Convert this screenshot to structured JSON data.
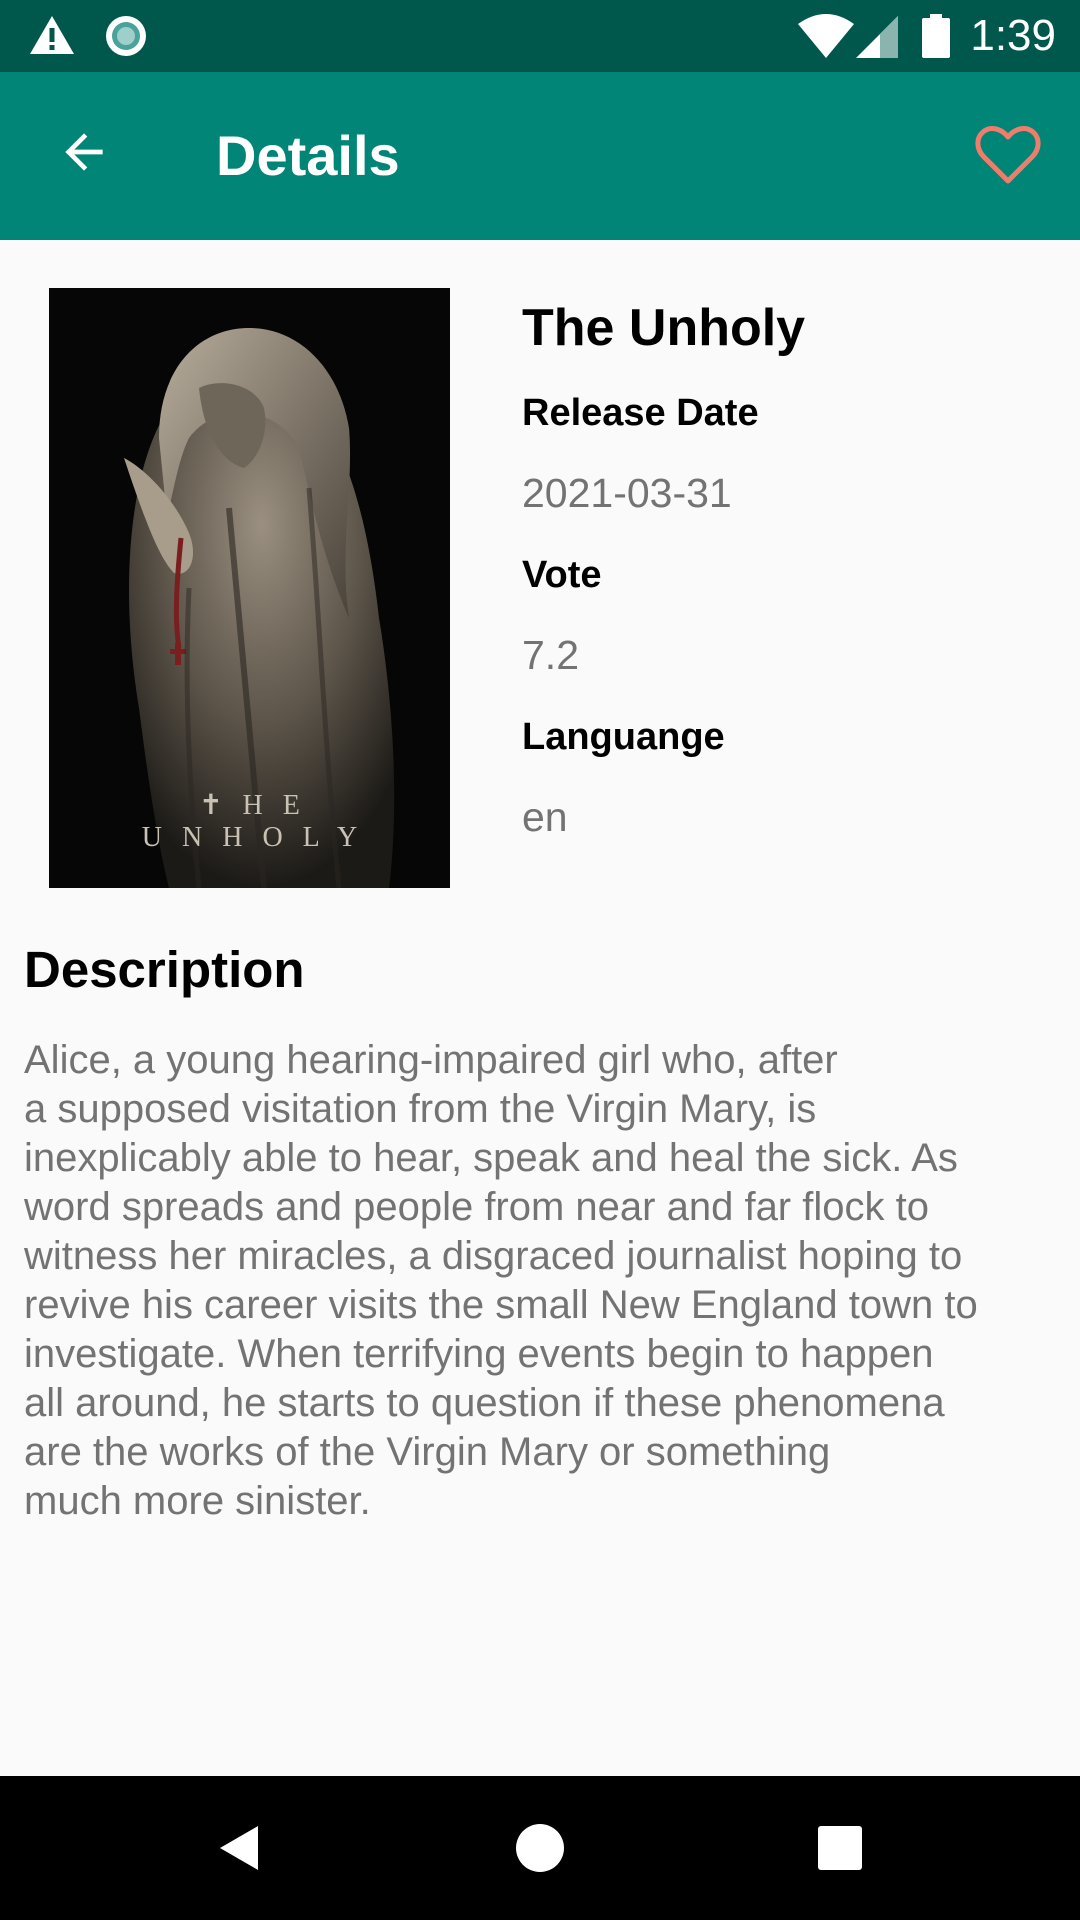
{
  "status_bar": {
    "time": "1:39",
    "icons": [
      "warning-icon",
      "sync-icon",
      "wifi-icon",
      "cell-signal-icon",
      "battery-icon"
    ]
  },
  "app_bar": {
    "title": "Details",
    "background": "#008577",
    "status_background": "#00574b",
    "favorite_color": "#ef7d6b"
  },
  "poster": {
    "title_text": "✝HE UNHOLY"
  },
  "movie": {
    "title": "The Unholy",
    "release_date_label": "Release Date",
    "release_date": "2021-03-31",
    "vote_label": "Vote",
    "vote": "7.2",
    "language_label": "Languange",
    "language": "en"
  },
  "description": {
    "heading": "Description",
    "lines": [
      "Alice, a young hearing-impaired girl who, after",
      "a supposed visitation from the Virgin Mary, is",
      "inexplicably able to hear, speak and heal the sick. As",
      "word spreads and people from near and far flock to",
      "witness her miracles, a disgraced journalist hoping to",
      "revive his career visits the small New England town to",
      "investigate. When terrifying events begin to happen",
      "all around, he starts to question if these phenomena",
      "are the works of the Virgin Mary or something",
      "much more sinister."
    ]
  },
  "nav_bar": {
    "buttons": [
      "back-triangle-icon",
      "home-circle-icon",
      "recents-square-icon"
    ]
  }
}
